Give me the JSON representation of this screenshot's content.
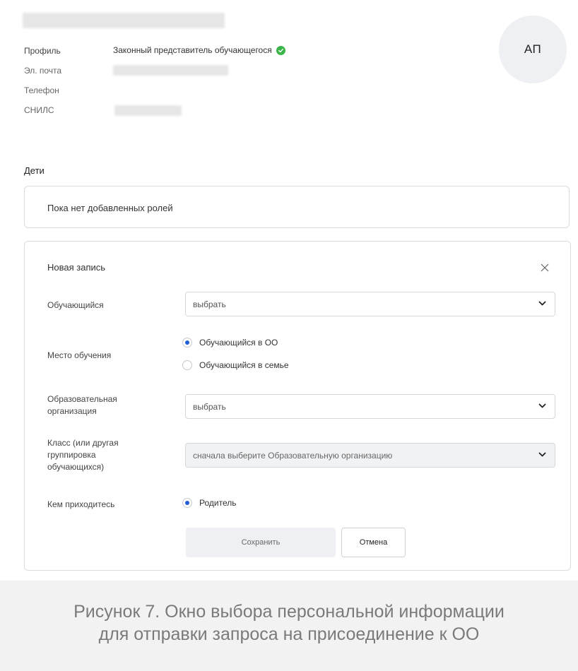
{
  "profile": {
    "avatar_initials": "АП",
    "profile_label": "Профиль",
    "profile_value": "Законный представитель обучающегося",
    "email_label": "Эл. почта",
    "phone_label": "Телефон",
    "snils_label": "СНИЛС",
    "verified_icon": "check-circle-icon"
  },
  "children": {
    "section_title": "Дети",
    "empty_text": "Пока нет добавленных ролей"
  },
  "form": {
    "title": "Новая запись",
    "student_label": "Обучающийся",
    "student_value": "выбрать",
    "place_label": "Место обучения",
    "place_options": [
      "Обучающийся в ОО",
      "Обучающийся в семье"
    ],
    "place_selected": "Обучающийся в ОО",
    "org_label_line1": "Образовательная",
    "org_label_line2": "организация",
    "org_value": "выбрать",
    "class_label_line1": "Класс (или другая",
    "class_label_line2": "группировка",
    "class_label_line3": "обучающихся)",
    "class_value": "сначала выберите Образовательную организацию",
    "relation_label": "Кем приходитесь",
    "relation_option": "Родитель",
    "save_label": "Сохранить",
    "cancel_label": "Отмена"
  },
  "caption": {
    "line1": "Рисунок 7. Окно выбора персональной информации",
    "line2": "для отправки запроса на присоединение к ОО"
  },
  "colors": {
    "accent": "#1f5ed4",
    "success": "#3bb54a",
    "border": "#d8dbe0"
  }
}
